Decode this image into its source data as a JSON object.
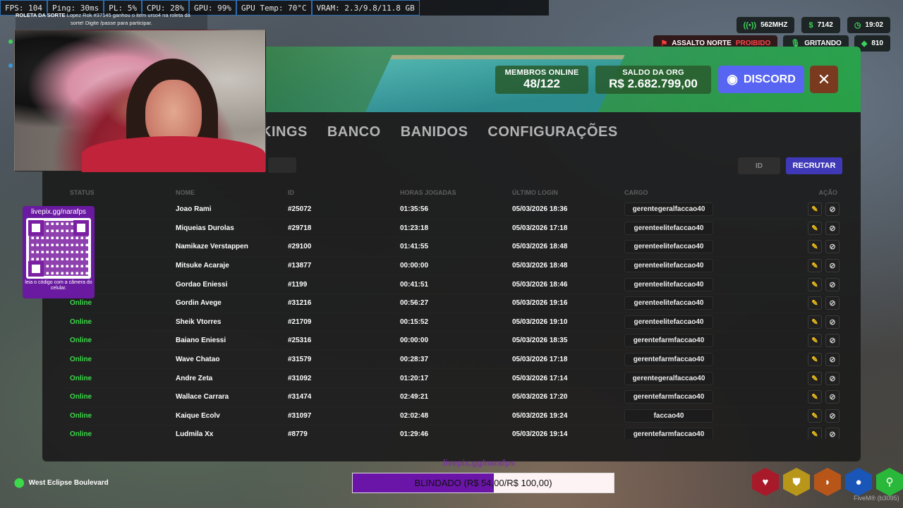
{
  "perf": [
    "FPS: 104",
    "Ping: 30ms",
    "PL: 5%",
    "CPU: 28%",
    "GPU: 99%",
    "GPU Temp: 70°C",
    "VRAM: 2.3/9.8/11.8 GB"
  ],
  "ticker": {
    "title": "ROLETA DA SORTE",
    "line1": "Lopez Rok #37145 ganhou o item urso4 na roleta da",
    "line2": "sorte! Digite /passe para participar."
  },
  "hud": {
    "radio": "562MHZ",
    "money": "7142",
    "time": "19:02",
    "alert_prefix": "ASSALTO NORTE",
    "alert_state": "PROIBIDO",
    "voice": "GRITANDO",
    "gems": "810"
  },
  "banner": {
    "members_label": "MEMBROS ONLINE",
    "members_value": "48/122",
    "balance_label": "SALDO DA ORG",
    "balance_value": "R$ 2.682.799,00",
    "discord_label": "DISCORD",
    "close_label": "✕"
  },
  "tabs": [
    "KINGS",
    "BANCO",
    "BANIDOS",
    "CONFIGURAÇÕES"
  ],
  "toolbar": {
    "id_placeholder": "ID",
    "recruit_label": "RECRUTAR"
  },
  "table": {
    "columns": [
      "STATUS",
      "NOME",
      "ID",
      "HORAS JOGADAS",
      "ÚLTIMO LOGIN",
      "CARGO",
      "AÇÃO"
    ],
    "rows": [
      {
        "status": "",
        "name": "Joao Rami",
        "id": "#25072",
        "hours": "01:35:56",
        "login": "05/03/2026 18:36",
        "cargo": "gerentegeralfaccao40"
      },
      {
        "status": "",
        "name": "Miqueias Durolas",
        "id": "#29718",
        "hours": "01:23:18",
        "login": "05/03/2026 17:18",
        "cargo": "gerenteelitefaccao40"
      },
      {
        "status": "",
        "name": "Namikaze Verstappen",
        "id": "#29100",
        "hours": "01:41:55",
        "login": "05/03/2026 18:48",
        "cargo": "gerenteelitefaccao40"
      },
      {
        "status": "",
        "name": "Mitsuke Acaraje",
        "id": "#13877",
        "hours": "00:00:00",
        "login": "05/03/2026 18:48",
        "cargo": "gerenteelitefaccao40"
      },
      {
        "status": "",
        "name": "Gordao Eniessi",
        "id": "#1199",
        "hours": "00:41:51",
        "login": "05/03/2026 18:46",
        "cargo": "gerenteelitefaccao40"
      },
      {
        "status": "Online",
        "name": "Gordin Avege",
        "id": "#31216",
        "hours": "00:56:27",
        "login": "05/03/2026 19:16",
        "cargo": "gerenteelitefaccao40"
      },
      {
        "status": "Online",
        "name": "Sheik Vtorres",
        "id": "#21709",
        "hours": "00:15:52",
        "login": "05/03/2026 19:10",
        "cargo": "gerenteelitefaccao40"
      },
      {
        "status": "Online",
        "name": "Baiano Eniessi",
        "id": "#25316",
        "hours": "00:00:00",
        "login": "05/03/2026 18:35",
        "cargo": "gerentefarmfaccao40"
      },
      {
        "status": "Online",
        "name": "Wave Chatao",
        "id": "#31579",
        "hours": "00:28:37",
        "login": "05/03/2026 17:18",
        "cargo": "gerentefarmfaccao40"
      },
      {
        "status": "Online",
        "name": "Andre Zeta",
        "id": "#31092",
        "hours": "01:20:17",
        "login": "05/03/2026 17:14",
        "cargo": "gerentegeralfaccao40"
      },
      {
        "status": "Online",
        "name": "Wallace Carrara",
        "id": "#31474",
        "hours": "02:49:21",
        "login": "05/03/2026 17:20",
        "cargo": "gerentefarmfaccao40"
      },
      {
        "status": "Online",
        "name": "Kaique Ecolv",
        "id": "#31097",
        "hours": "02:02:48",
        "login": "05/03/2026 19:24",
        "cargo": "faccao40"
      },
      {
        "status": "Online",
        "name": "Ludmila Xx",
        "id": "#8779",
        "hours": "01:29:46",
        "login": "05/03/2026 19:14",
        "cargo": "gerentefarmfaccao40"
      }
    ]
  },
  "qr": {
    "url": "livepix.gg/narafps",
    "hint": "leia o código com a câmera do celular."
  },
  "location": "West Eclipse Boulevard",
  "stream_url": "livepix.gg/narafps",
  "armor": {
    "label": "BLINDADO (R$ 54,00/R$ 100,00)",
    "fraction": 0.54
  },
  "status_icons": [
    {
      "name": "health-icon",
      "glyph": "♥",
      "color": "#a81a2a"
    },
    {
      "name": "armor-icon",
      "glyph": "⛊",
      "color": "#b8961a"
    },
    {
      "name": "food-icon",
      "glyph": "◗",
      "color": "#b8561a"
    },
    {
      "name": "water-icon",
      "glyph": "●",
      "color": "#1a56b8"
    },
    {
      "name": "stamina-icon",
      "glyph": "⚲",
      "color": "#2ab83a"
    }
  ],
  "footer": "FiveM® (b3095)"
}
